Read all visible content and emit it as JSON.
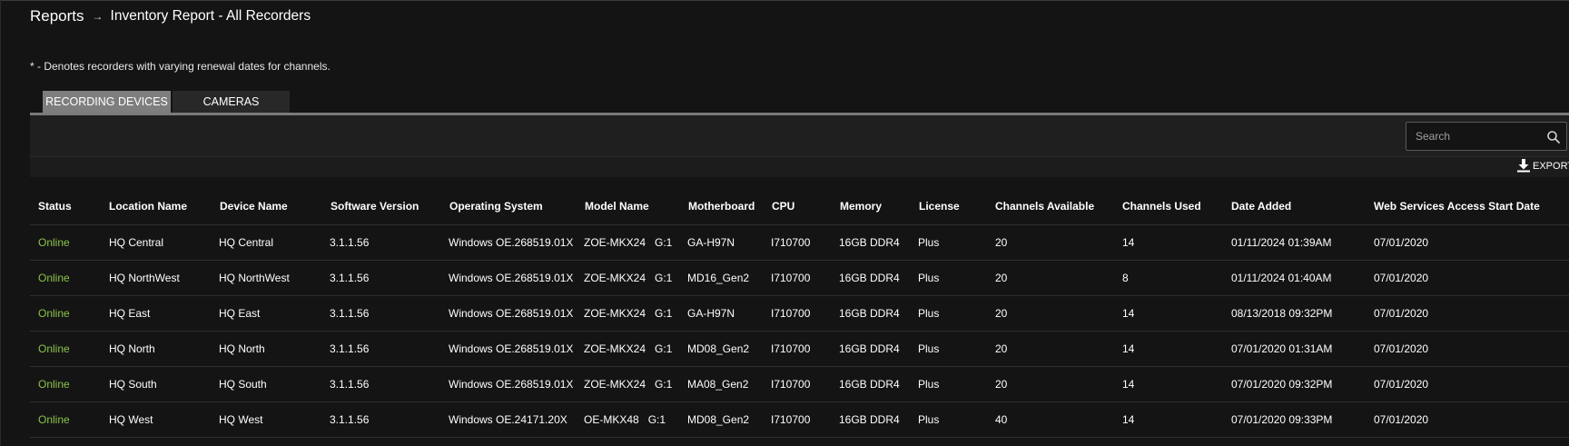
{
  "breadcrumb": {
    "root": "Reports",
    "separator": "→",
    "current": "Inventory Report - All Recorders"
  },
  "note": "* - Denotes recorders with varying renewal dates for channels.",
  "tabs": [
    {
      "label": "RECORDING DEVICES",
      "active": true
    },
    {
      "label": "CAMERAS",
      "active": false
    }
  ],
  "search": {
    "placeholder": "Search",
    "icon": "search-icon"
  },
  "export": {
    "label": "EXPORT",
    "icon": "download-icon"
  },
  "colors": {
    "online": "#8bc34a",
    "active_tab": "#7e7e7e",
    "background": "#141414"
  },
  "table": {
    "columns": [
      "Status",
      "Location Name",
      "Device Name",
      "Software Version",
      "Operating System",
      "Model Name",
      "Motherboard",
      "CPU",
      "Memory",
      "License",
      "Channels Available",
      "Channels Used",
      "Date Added",
      "Web Services Access Start Date"
    ],
    "rows": [
      {
        "status": "Online",
        "location": "HQ Central",
        "device": "HQ Central",
        "software": "3.1.1.56",
        "os": "Windows OE.268519.01X",
        "model": "ZOE-MKX24",
        "group": "G:1",
        "motherboard": "GA-H97N",
        "cpu": "I710700",
        "memory": "16GB DDR4",
        "license": "Plus",
        "channels_available": "20",
        "channels_used": "14",
        "date_added": "01/11/2024 01:39AM",
        "ws_start": "07/01/2020"
      },
      {
        "status": "Online",
        "location": "HQ NorthWest",
        "device": "HQ NorthWest",
        "software": "3.1.1.56",
        "os": "Windows OE.268519.01X",
        "model": "ZOE-MKX24",
        "group": "G:1",
        "motherboard": "MD16_Gen2",
        "cpu": "I710700",
        "memory": "16GB DDR4",
        "license": "Plus",
        "channels_available": "20",
        "channels_used": "8",
        "date_added": "01/11/2024 01:40AM",
        "ws_start": "07/01/2020"
      },
      {
        "status": "Online",
        "location": "HQ East",
        "device": "HQ East",
        "software": "3.1.1.56",
        "os": "Windows OE.268519.01X",
        "model": "ZOE-MKX24",
        "group": "G:1",
        "motherboard": "GA-H97N",
        "cpu": "I710700",
        "memory": "16GB DDR4",
        "license": "Plus",
        "channels_available": "20",
        "channels_used": "14",
        "date_added": "08/13/2018 09:32PM",
        "ws_start": "07/01/2020"
      },
      {
        "status": "Online",
        "location": "HQ North",
        "device": "HQ North",
        "software": "3.1.1.56",
        "os": "Windows OE.268519.01X",
        "model": "ZOE-MKX24",
        "group": "G:1",
        "motherboard": "MD08_Gen2",
        "cpu": "I710700",
        "memory": "16GB DDR4",
        "license": "Plus",
        "channels_available": "20",
        "channels_used": "14",
        "date_added": "07/01/2020 01:31AM",
        "ws_start": "07/01/2020"
      },
      {
        "status": "Online",
        "location": "HQ South",
        "device": "HQ South",
        "software": "3.1.1.56",
        "os": "Windows OE.268519.01X",
        "model": "ZOE-MKX24",
        "group": "G:1",
        "motherboard": "MA08_Gen2",
        "cpu": "I710700",
        "memory": "16GB DDR4",
        "license": "Plus",
        "channels_available": "20",
        "channels_used": "14",
        "date_added": "07/01/2020 09:32PM",
        "ws_start": "07/01/2020"
      },
      {
        "status": "Online",
        "location": "HQ West",
        "device": "HQ West",
        "software": "3.1.1.56",
        "os": "Windows OE.24171.20X",
        "model": "OE-MKX48",
        "group": "G:1",
        "motherboard": "MD08_Gen2",
        "cpu": "I710700",
        "memory": "16GB DDR4",
        "license": "Plus",
        "channels_available": "40",
        "channels_used": "14",
        "date_added": "07/01/2020 09:33PM",
        "ws_start": "07/01/2020"
      }
    ]
  }
}
